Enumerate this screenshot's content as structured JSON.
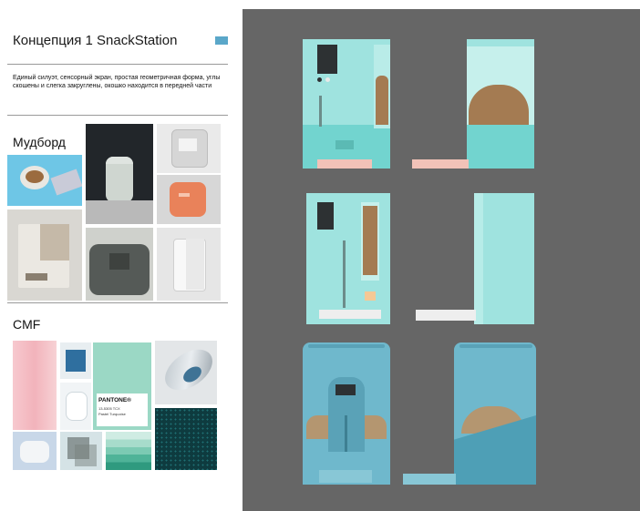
{
  "concept": {
    "title": "Концепция 1 SnackStation",
    "accent_color": "#5aa7c9",
    "description": "Единый силуэт, сенсорный экран, простая геометричная форма, углы скошены и слегка закруглены, окошко находится в передней части"
  },
  "moodboard": {
    "heading": "Мудборд"
  },
  "cmf": {
    "heading": "CMF",
    "pantone_label": "PANTONE®",
    "pantone_code": "13-5305 TCX",
    "pantone_name": "Pastel Turquoise"
  },
  "colors": {
    "canvas_gray": "#666666",
    "mint": "#9fe3df",
    "teal": "#72d4cf",
    "pink": "#f2c2b8",
    "blue": "#6fb8cc"
  }
}
